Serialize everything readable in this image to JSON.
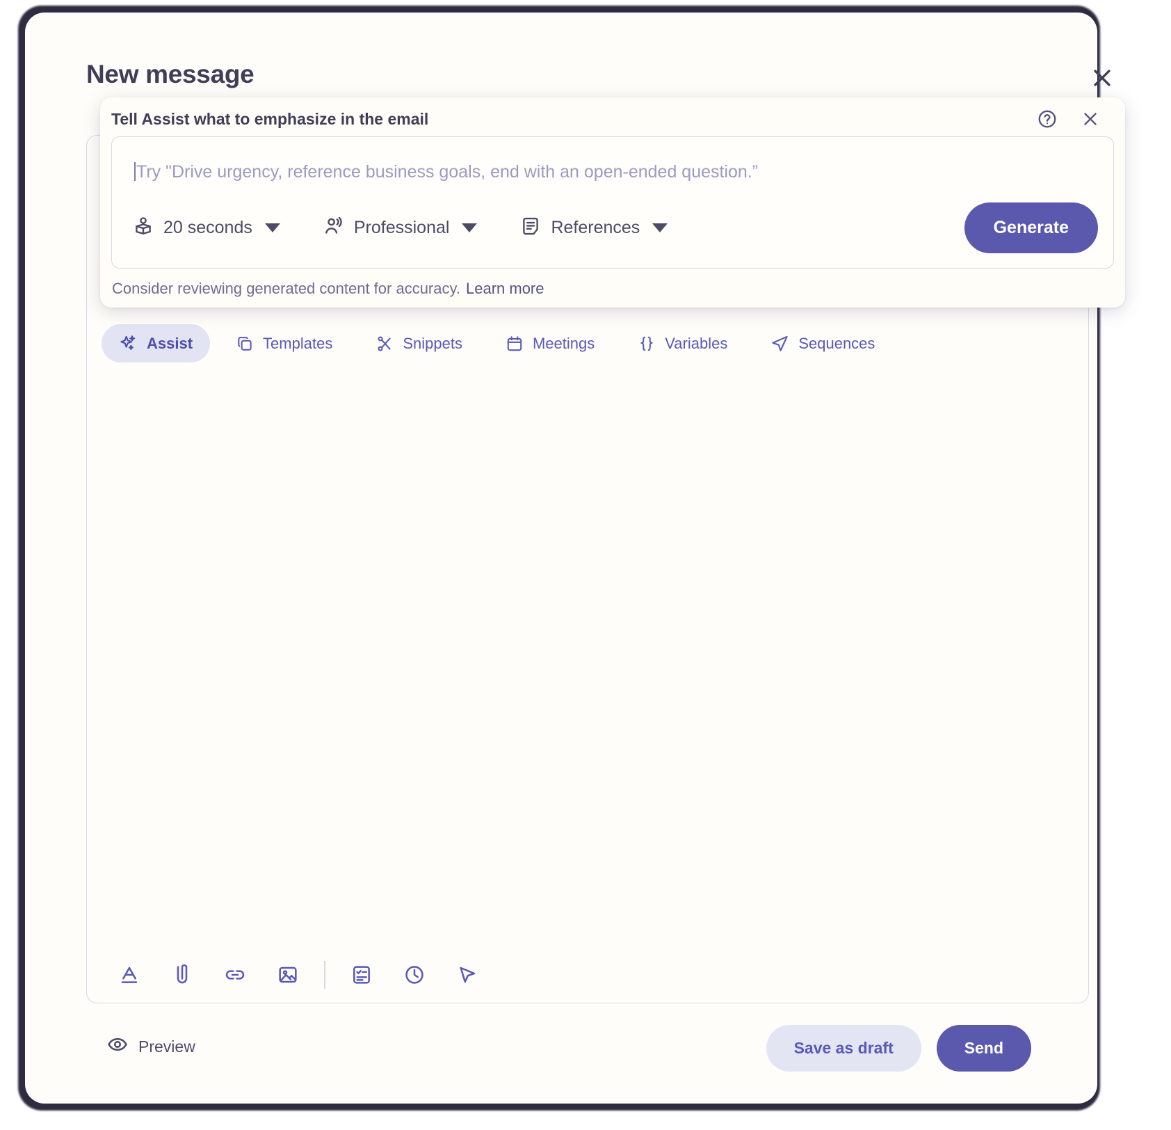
{
  "window": {
    "title": "New message",
    "close_icon": "close-icon"
  },
  "assist_popover": {
    "title": "Tell Assist what to emphasize in the email",
    "help_icon": "help-circle-icon",
    "close_icon": "close-icon",
    "prompt_value": "",
    "prompt_placeholder": "Try \"Drive urgency, reference business goals, end with an open-ended question.”",
    "controls": [
      {
        "id": "reading-time",
        "icon": "reading-person-icon",
        "label": "20 seconds"
      },
      {
        "id": "tone",
        "icon": "person-speaking-icon",
        "label": "Professional"
      },
      {
        "id": "references",
        "icon": "document-lines-icon",
        "label": "References"
      }
    ],
    "generate_label": "Generate",
    "disclaimer": "Consider reviewing generated content for accuracy.",
    "learn_more": "Learn more"
  },
  "tabs": [
    {
      "id": "assist",
      "icon": "sparkles-icon",
      "label": "Assist",
      "active": true
    },
    {
      "id": "templates",
      "icon": "copy-icon",
      "label": "Templates",
      "active": false
    },
    {
      "id": "snippets",
      "icon": "scissors-icon",
      "label": "Snippets",
      "active": false
    },
    {
      "id": "meetings",
      "icon": "calendar-icon",
      "label": "Meetings",
      "active": false
    },
    {
      "id": "variables",
      "icon": "braces-icon",
      "label": "Variables",
      "active": false
    },
    {
      "id": "sequences",
      "icon": "send-plane-icon",
      "label": "Sequences",
      "active": false
    }
  ],
  "format_toolbar": [
    {
      "id": "text-format",
      "icon": "text-format-a-icon"
    },
    {
      "id": "attachment",
      "icon": "paperclip-icon"
    },
    {
      "id": "link",
      "icon": "link-icon"
    },
    {
      "id": "image",
      "icon": "image-icon"
    },
    {
      "id": "separator",
      "icon": "divider"
    },
    {
      "id": "task",
      "icon": "checklist-card-icon"
    },
    {
      "id": "schedule",
      "icon": "clock-icon"
    },
    {
      "id": "tracking",
      "icon": "cursor-arrow-icon"
    }
  ],
  "footer": {
    "preview_label": "Preview",
    "preview_icon": "eye-icon",
    "save_draft_label": "Save as draft",
    "send_label": "Send"
  },
  "colors": {
    "accent": "#5b59ad",
    "accent_soft": "#e2e3f3",
    "text_dark": "#403d56",
    "text_muted": "#6f6c90",
    "placeholder": "#9d9ac2",
    "border": "#d8d7e6",
    "surface": "#fffdf9",
    "frame": "#2f2c42"
  }
}
